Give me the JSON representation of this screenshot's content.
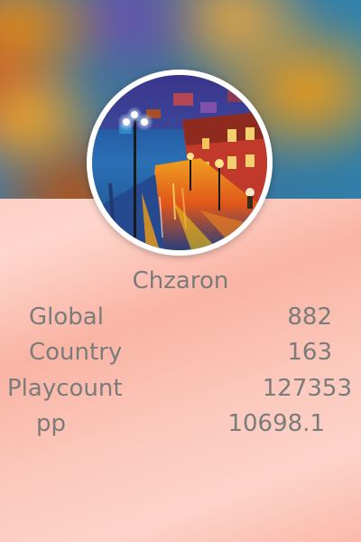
{
  "profile": {
    "username": "Chzaron",
    "avatar_art": "rainy-night-street-painting"
  },
  "stats": [
    {
      "label": "Global",
      "value": "882"
    },
    {
      "label": "Country",
      "value": "163"
    },
    {
      "label": "Playcount",
      "value": "127353"
    },
    {
      "label": "pp",
      "value": "10698.1"
    }
  ],
  "colors": {
    "text": "#7b7b7b",
    "background": "#fbc3b6",
    "ring": "#ffffff"
  }
}
